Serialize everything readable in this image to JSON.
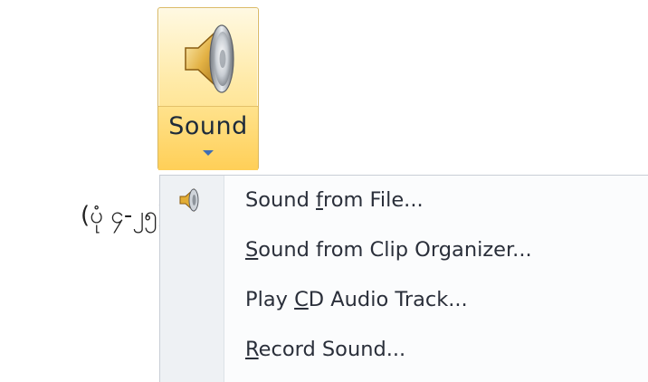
{
  "ribbon": {
    "sound_button": {
      "label": "Sound",
      "icon": "speaker-icon",
      "dropdown_icon": "chevron-down-icon"
    }
  },
  "caption": "(ပုံ ၄-၂၅)",
  "menu": {
    "items": [
      {
        "pre": "Sound ",
        "mnemonic": "f",
        "post": "rom File...",
        "icon": "speaker-icon"
      },
      {
        "pre": "",
        "mnemonic": "S",
        "post": "ound from Clip Organizer...",
        "icon": ""
      },
      {
        "pre": "Play ",
        "mnemonic": "C",
        "post": "D Audio Track...",
        "icon": ""
      },
      {
        "pre": "",
        "mnemonic": "R",
        "post": "ecord Sound...",
        "icon": ""
      }
    ]
  },
  "colors": {
    "button_top": "#ffeaa8",
    "button_bottom": "#ffcf57",
    "button_border": "#d9b861",
    "menu_gutter": "#eef1f4",
    "arrow": "#3f6db3"
  }
}
